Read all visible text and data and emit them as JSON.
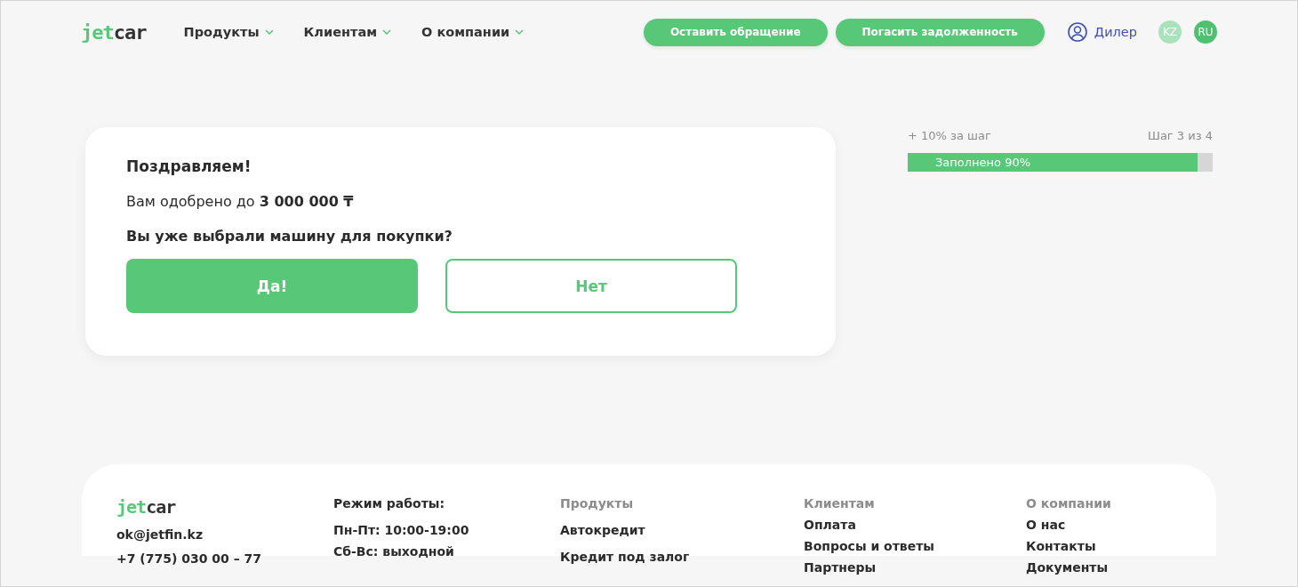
{
  "header": {
    "logo": {
      "accent": "jet",
      "rest": "car"
    },
    "nav": [
      {
        "label": "Продукты"
      },
      {
        "label": "Клиентам"
      },
      {
        "label": "О компании"
      }
    ],
    "actions": [
      "Оставить обращение",
      "Погасить задолженность"
    ],
    "account": "Дилер",
    "languages": [
      {
        "label": "KZ",
        "selected": false
      },
      {
        "label": "RU",
        "selected": true
      }
    ]
  },
  "offer": {
    "title": "Поздравляем!",
    "approved": "Вам одобрено до **3 000 000 ₸**",
    "question": "Вы уже выбрали машину для покупки?",
    "yes": "Да!",
    "no": "Нет"
  },
  "progress": {
    "bonus": "+ 10% за шаг",
    "step": "Шаг 3 из 4",
    "label": "Заполнено 90%",
    "level": 0.95
  },
  "footer": {
    "logo": {
      "accent": "jet",
      "rest": "car"
    },
    "email": "ok@jetfin.kz",
    "phone": "+7 (775) 030 00 – 77",
    "hours_title": "Режим работы:",
    "hours": [
      "Пн-Пт: 10:00-19:00",
      "Сб-Вс: выходной"
    ],
    "columns": [
      {
        "title": "Продукты",
        "links": [
          "Автокредит",
          "Кредит под залог"
        ]
      },
      {
        "title": "Клиентам",
        "links": [
          "Оплата",
          "Вопросы и ответы",
          "Партнеры"
        ]
      },
      {
        "title": "О компании",
        "links": [
          "О нас",
          "Контакты",
          "Документы"
        ]
      }
    ]
  }
}
